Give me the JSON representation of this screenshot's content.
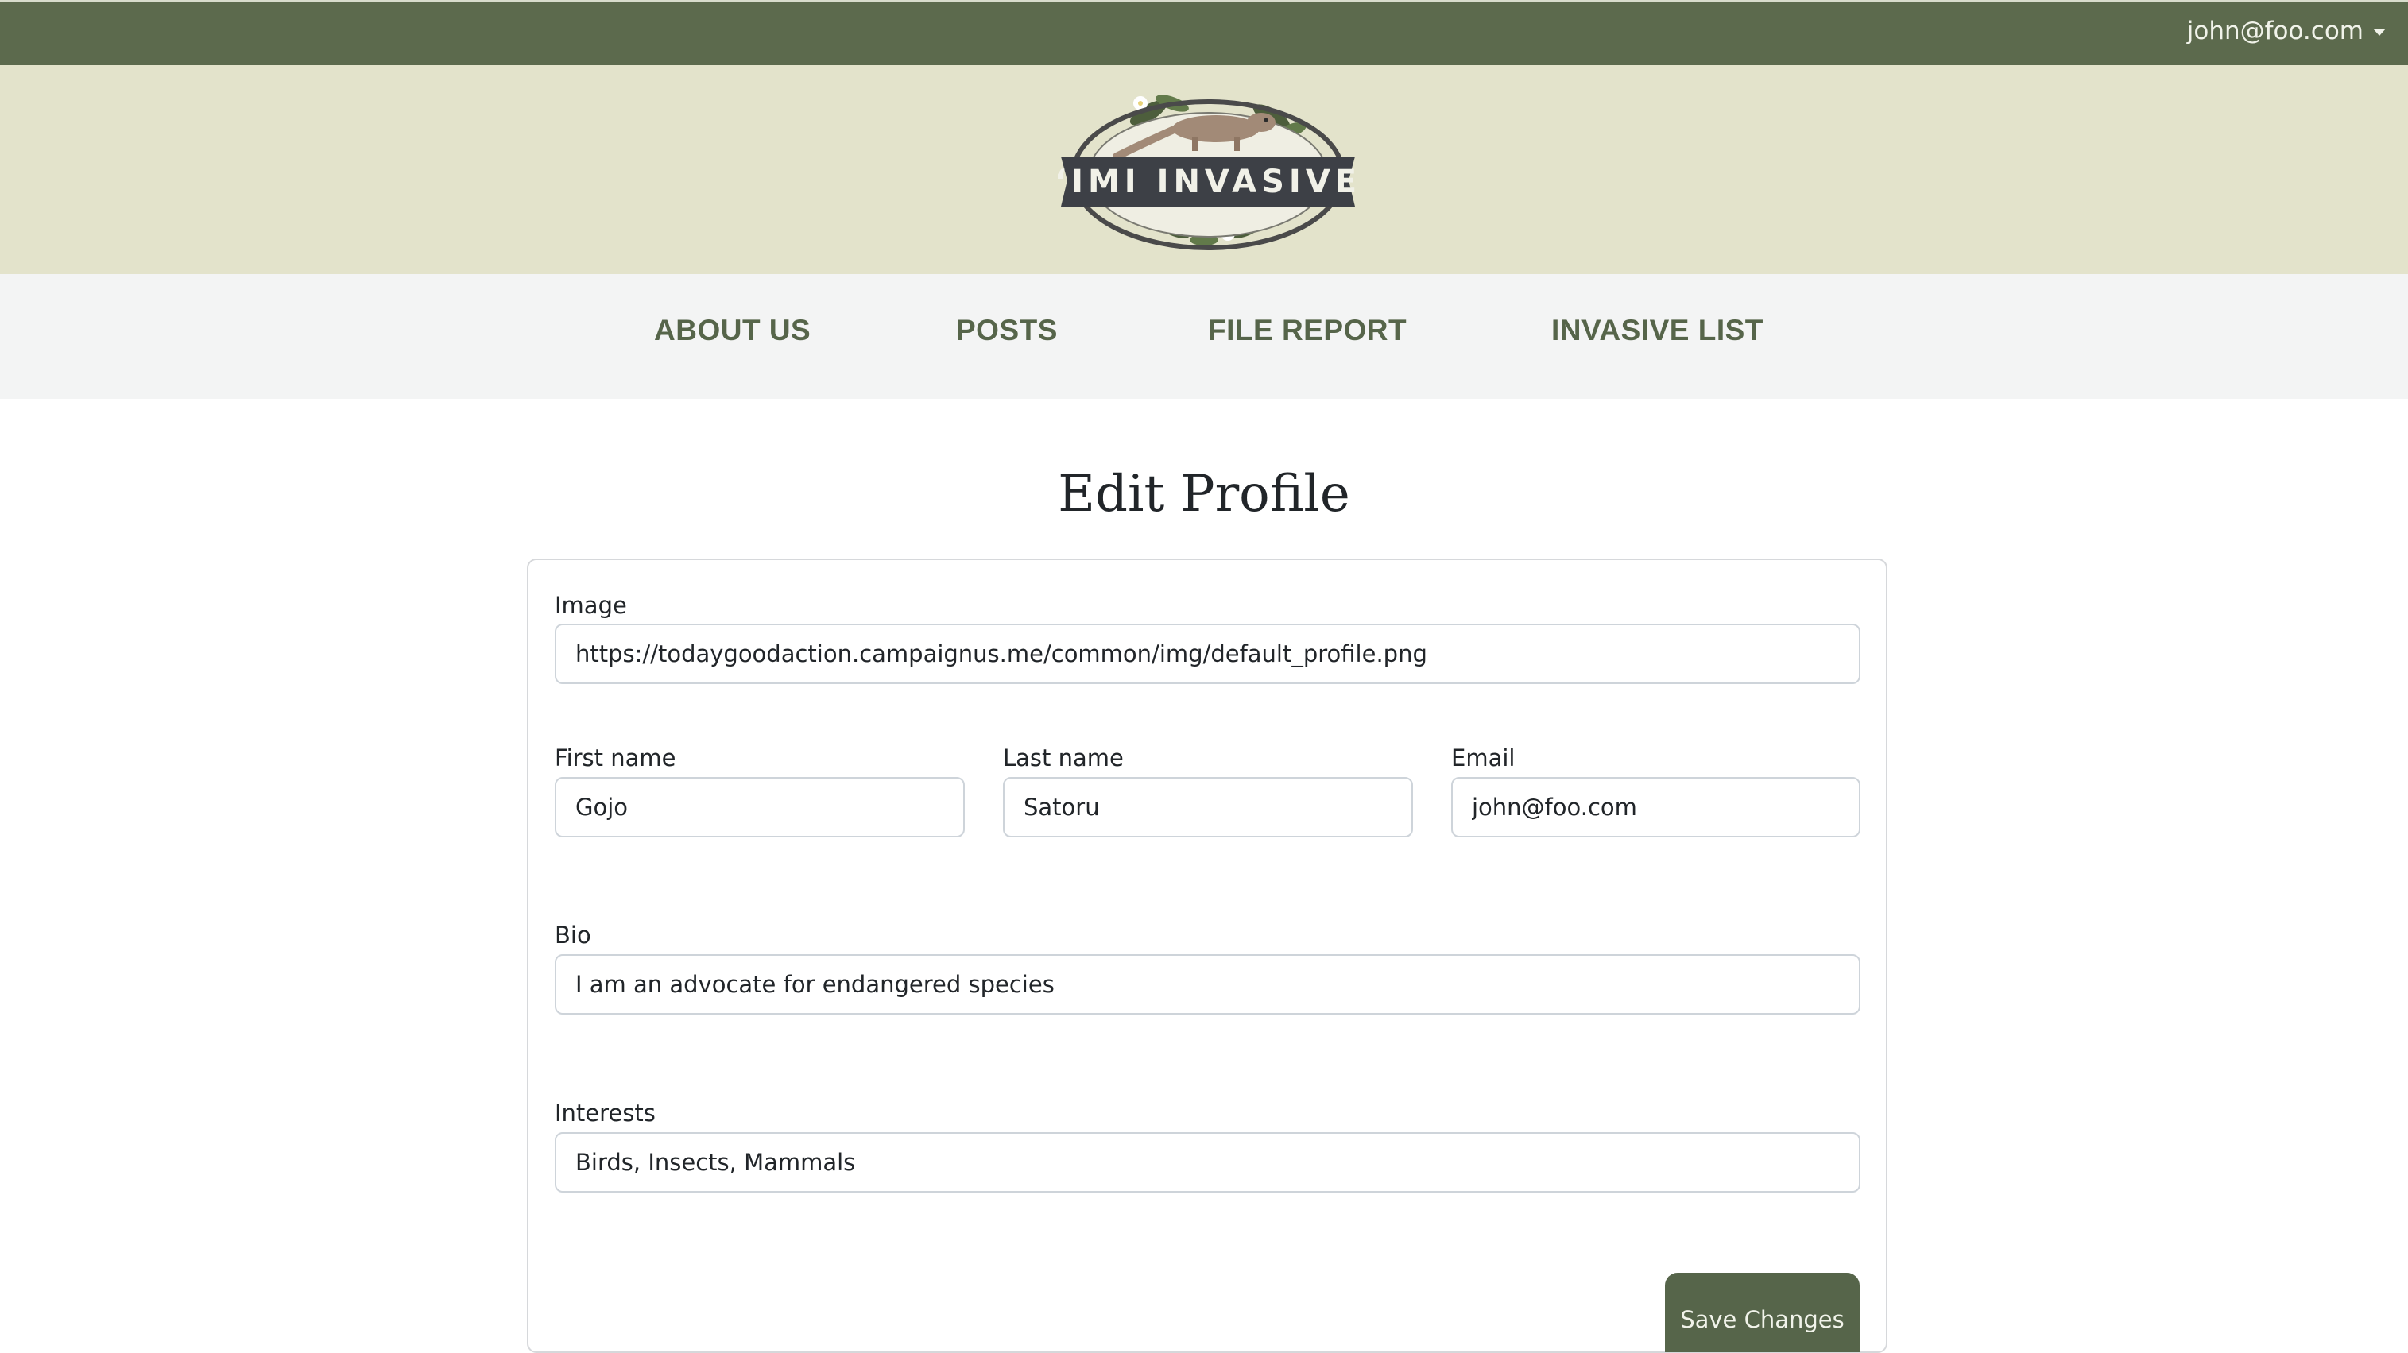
{
  "user_menu": {
    "label": "john@foo.com"
  },
  "logo": {
    "text": "‘IMI INVASIVE",
    "icon": "mongoose-logo-icon"
  },
  "nav": {
    "items": [
      {
        "label": "ABOUT US"
      },
      {
        "label": "POSTS"
      },
      {
        "label": "FILE REPORT"
      },
      {
        "label": "INVASIVE LIST"
      }
    ]
  },
  "page": {
    "title": "Edit Profile"
  },
  "form": {
    "image": {
      "label": "Image",
      "value": "https://todaygoodaction.campaignus.me/common/img/default_profile.png"
    },
    "first_name": {
      "label": "First name",
      "value": "Gojo"
    },
    "last_name": {
      "label": "Last name",
      "value": "Satoru"
    },
    "email": {
      "label": "Email",
      "value": "john@foo.com"
    },
    "bio": {
      "label": "Bio",
      "value": "I am an advocate for endangered species"
    },
    "interests": {
      "label": "Interests",
      "value": "Birds, Insects, Mammals"
    },
    "save_label": "Save Changes"
  },
  "colors": {
    "topbar": "#5c6a4d",
    "banner": "#e3e3cb",
    "nav_text": "#56654a",
    "button": "#56654a"
  }
}
